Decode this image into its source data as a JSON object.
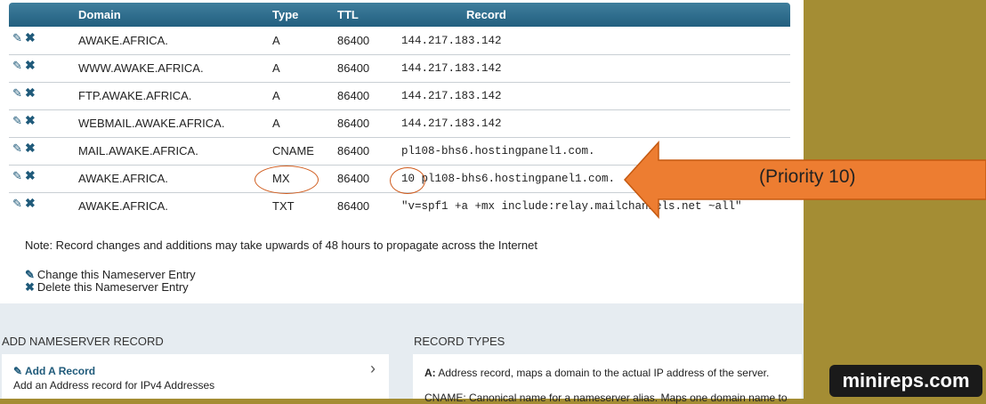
{
  "table": {
    "headers": {
      "domain": "Domain",
      "type": "Type",
      "ttl": "TTL",
      "record": "Record"
    },
    "rows": [
      {
        "domain": "AWAKE.AFRICA.",
        "type": "A",
        "ttl": "86400",
        "record": "144.217.183.142"
      },
      {
        "domain": "WWW.AWAKE.AFRICA.",
        "type": "A",
        "ttl": "86400",
        "record": "144.217.183.142"
      },
      {
        "domain": "FTP.AWAKE.AFRICA.",
        "type": "A",
        "ttl": "86400",
        "record": "144.217.183.142"
      },
      {
        "domain": "WEBMAIL.AWAKE.AFRICA.",
        "type": "A",
        "ttl": "86400",
        "record": "144.217.183.142"
      },
      {
        "domain": "MAIL.AWAKE.AFRICA.",
        "type": "CNAME",
        "ttl": "86400",
        "record": "pl108-bhs6.hostingpanel1.com."
      },
      {
        "domain": "AWAKE.AFRICA.",
        "type": "MX",
        "ttl": "86400",
        "record": "10 pl108-bhs6.hostingpanel1.com."
      },
      {
        "domain": "AWAKE.AFRICA.",
        "type": "TXT",
        "ttl": "86400",
        "record": "\"v=spf1 +a +mx include:relay.mailchannels.net ~all\""
      }
    ]
  },
  "note": "Note: Record changes and additions may take upwards of 48 hours to propagate across the Internet",
  "links": {
    "change": "Change this Nameserver Entry",
    "delete": "Delete this Nameserver Entry"
  },
  "add_section": {
    "title": "ADD NAMESERVER RECORD",
    "item_title": "Add A Record",
    "item_desc": "Add an Address record for IPv4 Addresses"
  },
  "types_section": {
    "title": "RECORD TYPES",
    "a_label": "A:",
    "a_desc": " Address record, maps a domain to the actual IP address of the server.",
    "cname_partial": "CNAME: Canonical name for a nameserver alias. Maps one domain name to"
  },
  "annotation": {
    "callout": "(Priority 10)",
    "color": "#ed7d31"
  },
  "watermark": "minireps.com",
  "colors": {
    "header": "#225f7f",
    "icon": "#1f5a7a",
    "background": "#a48d34"
  }
}
